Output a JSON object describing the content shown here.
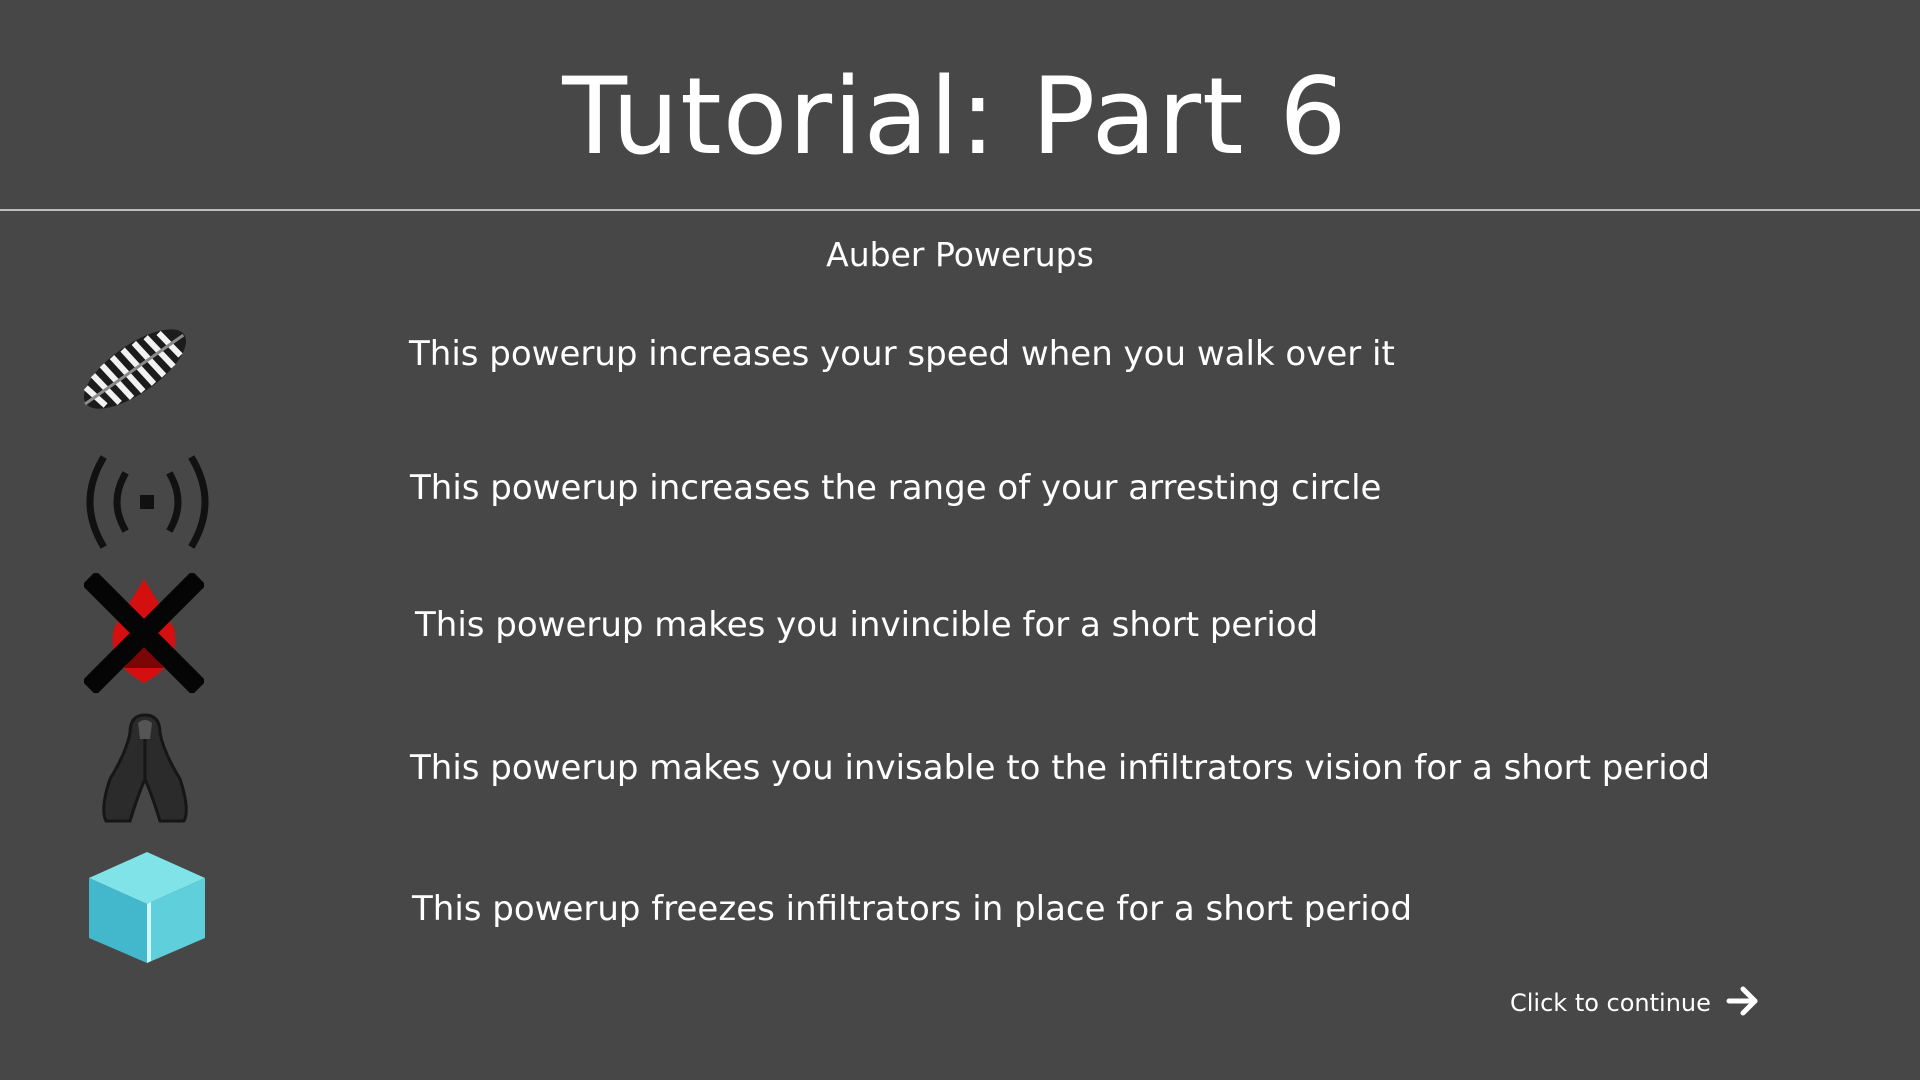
{
  "header": {
    "title": "Tutorial: Part 6"
  },
  "section": {
    "heading": "Auber Powerups"
  },
  "powerups": [
    {
      "icon": "speed-feather-icon",
      "description": "This powerup increases your speed when you walk over it"
    },
    {
      "icon": "signal-range-icon",
      "description": "This powerup increases the range of your arresting circle"
    },
    {
      "icon": "invincible-cross-icon",
      "description": "This powerup makes you invincible for a short period"
    },
    {
      "icon": "cloaked-figure-icon",
      "description": "This powerup makes you invisable to the infiltrators vision for a short period"
    },
    {
      "icon": "ice-cube-icon",
      "description": "This powerup freezes infiltrators in place for a short period"
    }
  ],
  "footer": {
    "continue_label": "Click to continue",
    "continue_icon": "arrow-right-icon"
  },
  "colors": {
    "background": "#474747",
    "text": "#ffffff",
    "divider": "#bdbdbd",
    "ice": "#6fd9e0",
    "danger_red": "#d40f0f"
  }
}
